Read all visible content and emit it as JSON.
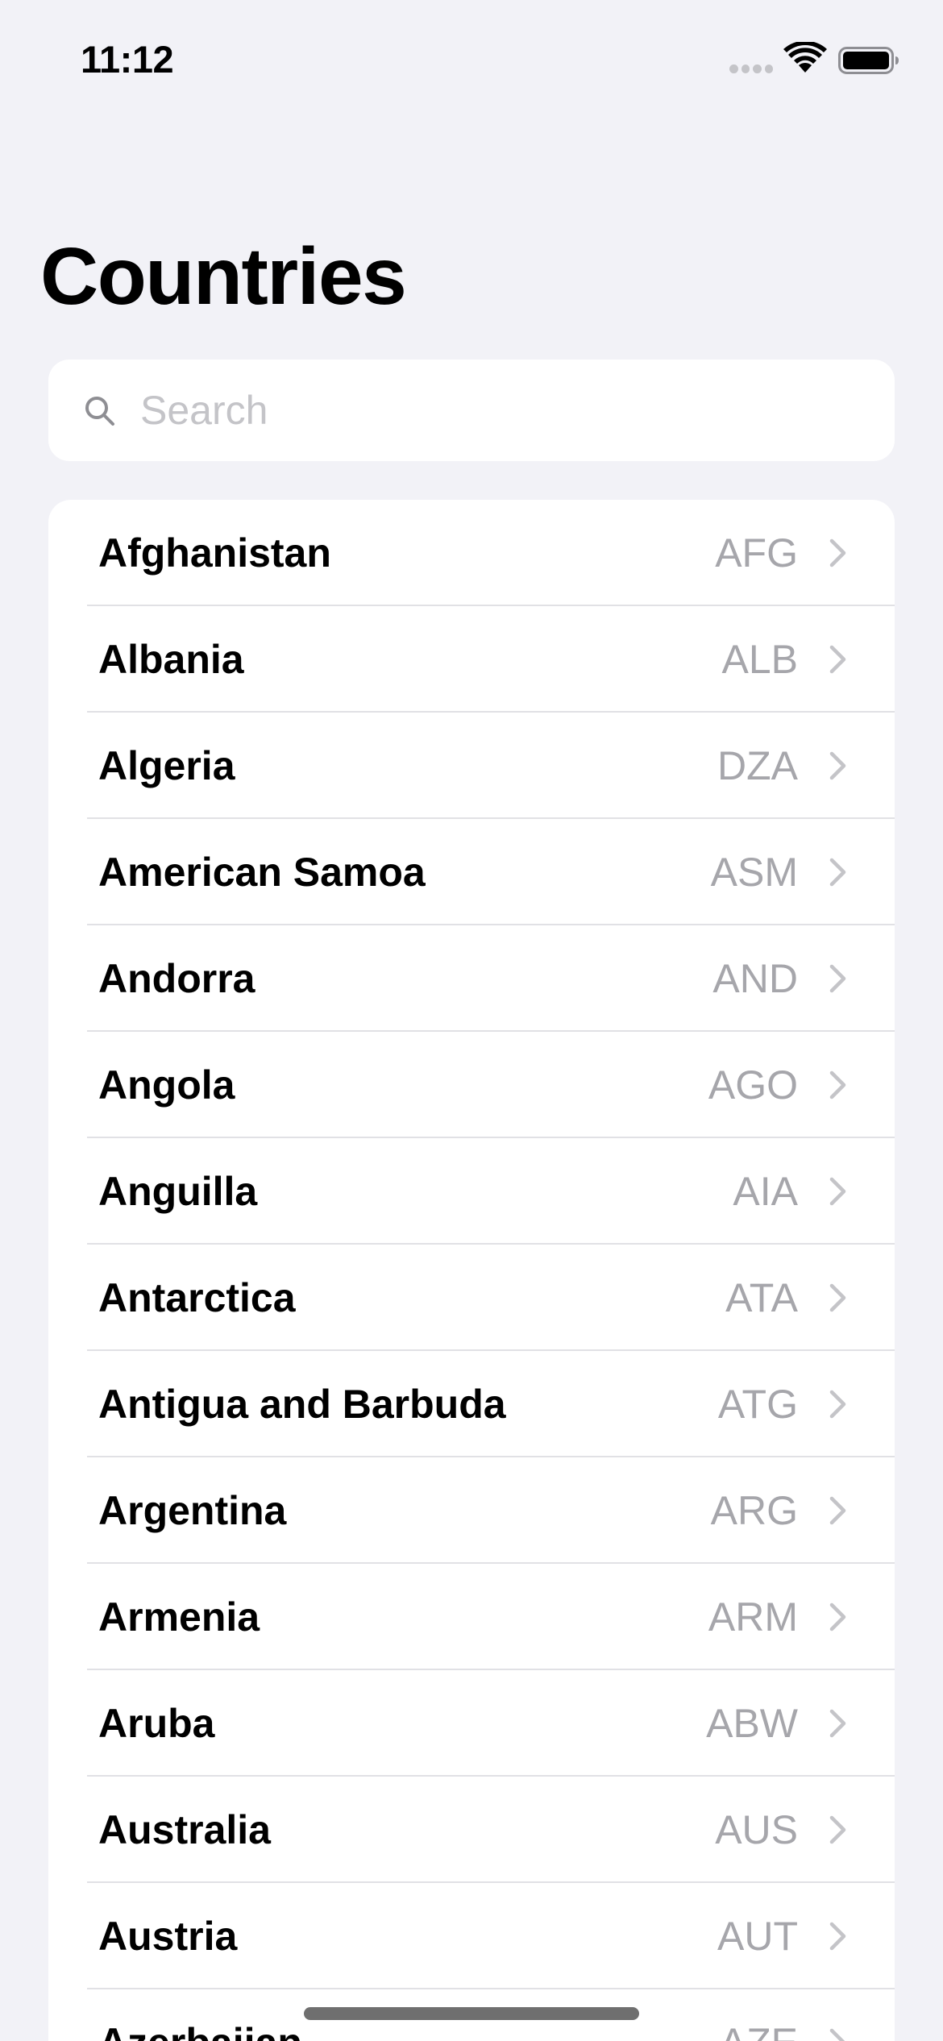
{
  "status_bar": {
    "time": "11:12"
  },
  "page": {
    "title": "Countries"
  },
  "search": {
    "placeholder": "Search",
    "value": ""
  },
  "countries": [
    {
      "name": "Afghanistan",
      "code": "AFG"
    },
    {
      "name": "Albania",
      "code": "ALB"
    },
    {
      "name": "Algeria",
      "code": "DZA"
    },
    {
      "name": "American Samoa",
      "code": "ASM"
    },
    {
      "name": "Andorra",
      "code": "AND"
    },
    {
      "name": "Angola",
      "code": "AGO"
    },
    {
      "name": "Anguilla",
      "code": "AIA"
    },
    {
      "name": "Antarctica",
      "code": "ATA"
    },
    {
      "name": "Antigua and Barbuda",
      "code": "ATG"
    },
    {
      "name": "Argentina",
      "code": "ARG"
    },
    {
      "name": "Armenia",
      "code": "ARM"
    },
    {
      "name": "Aruba",
      "code": "ABW"
    },
    {
      "name": "Australia",
      "code": "AUS"
    },
    {
      "name": "Austria",
      "code": "AUT"
    },
    {
      "name": "Azerbaijan",
      "code": "AZE"
    }
  ],
  "icons": {
    "wifi": "wifi-icon",
    "battery": "battery-icon",
    "search": "search-icon",
    "chevron": "chevron-right-icon"
  },
  "colors": {
    "background": "#f2f2f7",
    "card": "#ffffff",
    "secondary_text": "#a6a6ab",
    "separator": "#e1e1e5",
    "placeholder": "#c4c4c8"
  }
}
